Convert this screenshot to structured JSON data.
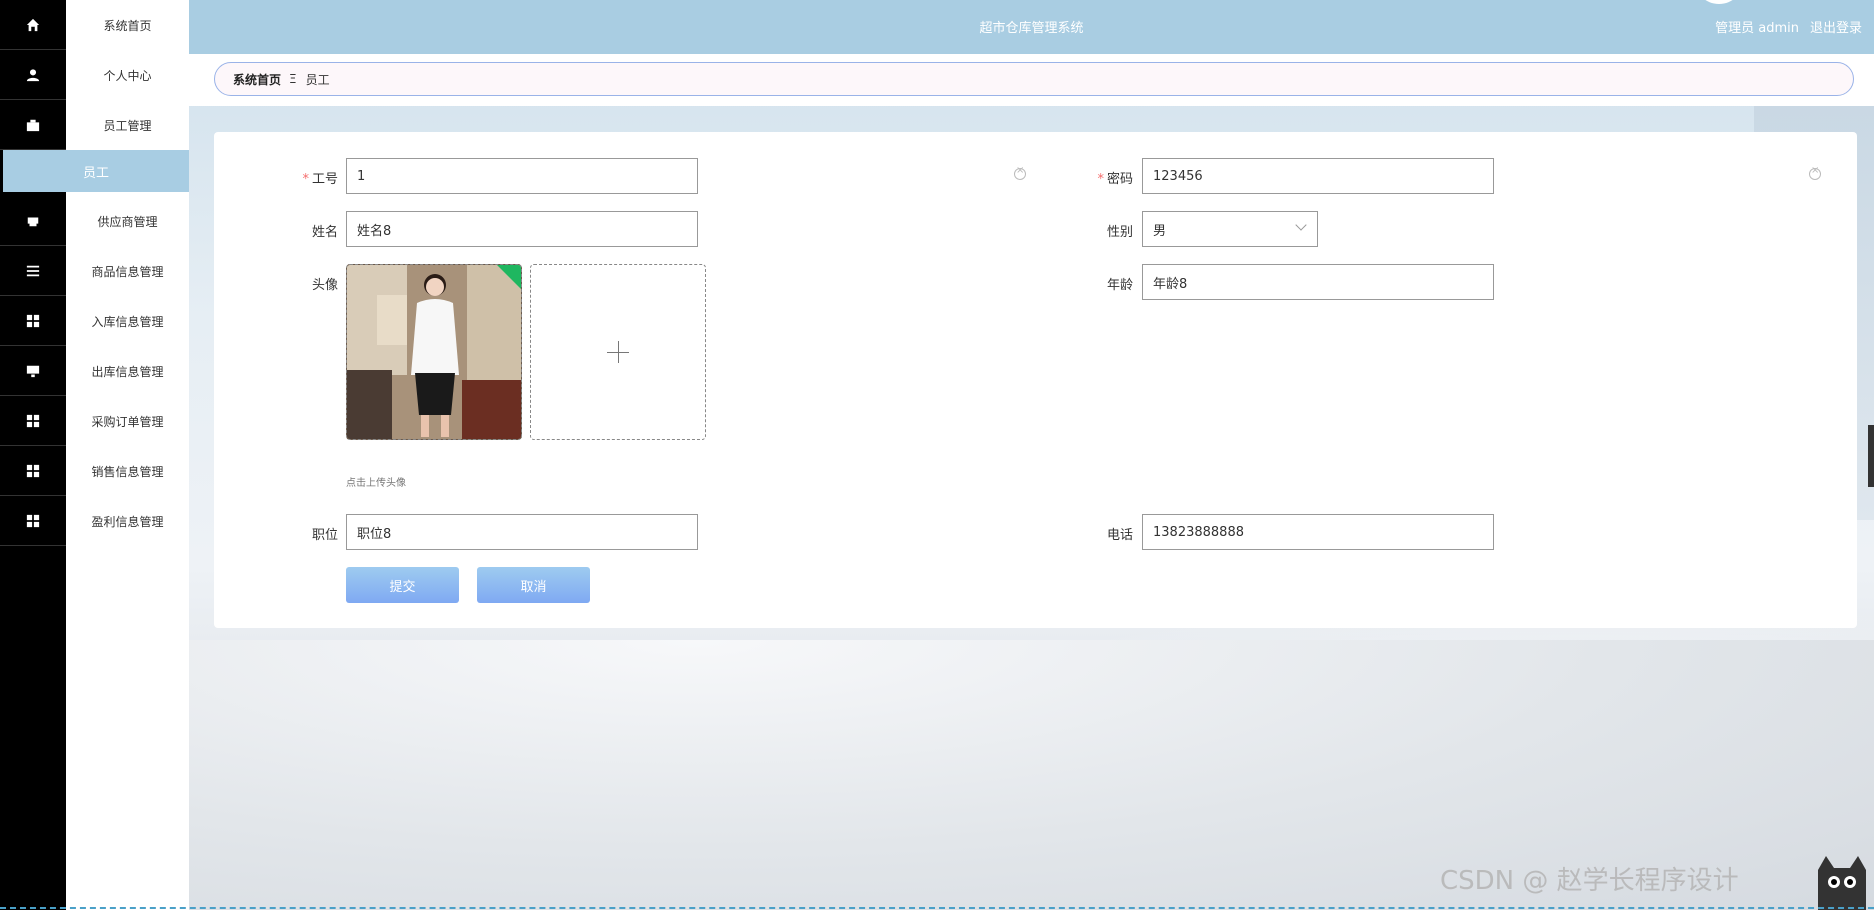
{
  "header": {
    "title": "超市仓库管理系统",
    "user": "管理员 admin",
    "logout": "退出登录"
  },
  "menu": {
    "items": [
      {
        "label": "系统首页",
        "icon": "home-icon"
      },
      {
        "label": "个人中心",
        "icon": "user-icon"
      },
      {
        "label": "员工管理",
        "icon": "briefcase-icon"
      },
      {
        "label": "供应商管理",
        "icon": "print-icon"
      },
      {
        "label": "商品信息管理",
        "icon": "list-icon"
      },
      {
        "label": "入库信息管理",
        "icon": "grid-icon"
      },
      {
        "label": "出库信息管理",
        "icon": "monitor-icon"
      },
      {
        "label": "采购订单管理",
        "icon": "grid-icon"
      },
      {
        "label": "销售信息管理",
        "icon": "grid-icon"
      },
      {
        "label": "盈利信息管理",
        "icon": "grid-icon"
      }
    ],
    "active_submenu": "员工"
  },
  "breadcrumb": {
    "home": "系统首页",
    "separator": "Ξ",
    "current": "员工"
  },
  "form": {
    "employee_id": {
      "label": "工号",
      "value": "1",
      "required": true
    },
    "password": {
      "label": "密码",
      "value": "123456",
      "required": true
    },
    "name": {
      "label": "姓名",
      "value": "姓名8"
    },
    "gender": {
      "label": "性别",
      "value": "男"
    },
    "avatar": {
      "label": "头像",
      "hint": "点击上传头像"
    },
    "age": {
      "label": "年龄",
      "value": "年龄8"
    },
    "position": {
      "label": "职位",
      "value": "职位8"
    },
    "phone": {
      "label": "电话",
      "value": "13823888888"
    },
    "required_mark": "*",
    "submit": "提交",
    "cancel": "取消"
  },
  "watermark": "CSDN @ 赵学长程序设计",
  "colors": {
    "header_bg": "#a9cde2",
    "active_menu_bg": "#a8cde3",
    "button_bg": "#8fb4f1",
    "sidebar_bg": "#000000",
    "required": "#f56c6c"
  }
}
